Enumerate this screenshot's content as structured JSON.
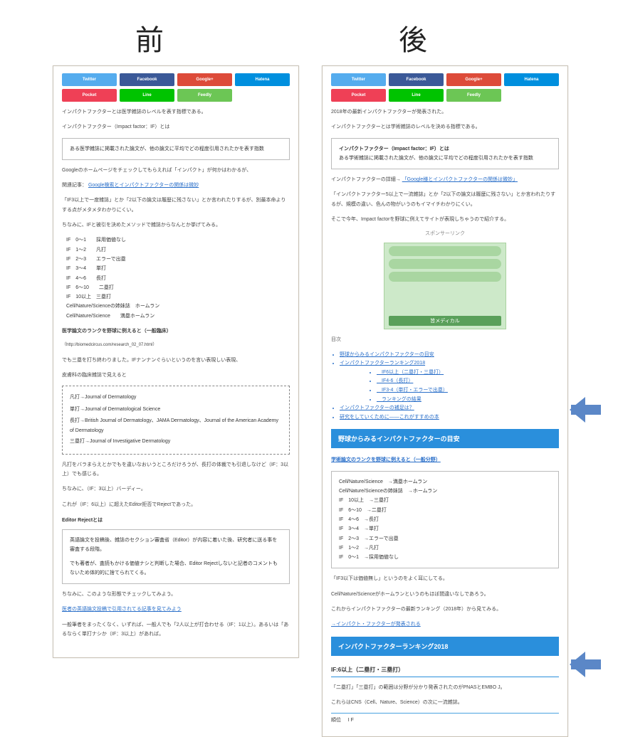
{
  "labels": {
    "before": "前",
    "after": "後"
  },
  "share": {
    "twitter": "Twitter",
    "facebook": "Facebook",
    "google": "Google+",
    "hatena": "Hatena",
    "pocket": "Pocket",
    "line": "Line",
    "feedly": "Feedly"
  },
  "before_panel": {
    "intro1": "インパクトファクターとは医学雑誌のレベルを表す指標である。",
    "intro2": "インパクトファクター（Impact factor：IF）とは",
    "box1": "ある医学雑誌に掲載された論文が、他の論文に平均でどの程度引用されたかを表す指数",
    "p_google": "Googleのホームページをチェックしてもらえれば「インパクト」が何かはわかるが、",
    "link_label": "関連記事：",
    "link1": "Google検索とインパクトファクターの関係は微妙",
    "p_if": "「IF3以上で一度雑誌」とか「2以下の論文は履歴に残さない」とか言われたりするが、別最本命よりする点がメタメタわかりにくい。",
    "p_memo": "ちなみに、IFと被引を決めたメソッドで雑誌からなんとか挙げてみる。",
    "if_rows": [
      "IF　0～1　　採用価値なし",
      "IF　1～2　　凡打",
      "IF　2～3　　エラーで出塁",
      "IF　3～4　　単打",
      "IF　4～6　　長打",
      "IF　6～10　　二塁打",
      "IF　10以上　三塁打",
      "Cell/Nature/Scienceの姉妹誌　ホームラン",
      "Cell/Nature/Science　　満塁ホームラン"
    ],
    "bold_line": "医学論文のランクを野球に例えると（一般臨床）",
    "url": "（http://biomedcircus.com/research_02_07.html）",
    "p_hit": "でも三塁を打ち終わりました。IFナンナンぐらいというのを言い表現しい表現、",
    "p_skin": "皮膚科の臨床雑誌で見えると",
    "jrnl_rows": [
      "凡打→Journal of Dermatology",
      "",
      "単打→Journal of Dermatological Science",
      "",
      "長打→British Journal of Dermatology、JAMA Dermatology、Journal of the American Academy of Dermatology",
      "",
      "三塁打→Journal of Investigative Dermatology"
    ],
    "p_hit2": "凡打をバラまらえとかでもを違いなおいうところだけろうが、長打の体裁でも引退しなけど（IF：3以上）でも感じる。",
    "p_jid": "ちなみに、（IF：3以上）バーディー。",
    "p_jid2": "これが（IF：6以上）に超えたEditor拒否でRejectであった。",
    "er_title": "Editor Rejectとは",
    "er_box1": "英語論文を投稿後、雑誌のセクション審査省（Editor）が内容に着いた後、研究者に送る事を審査する段階。",
    "er_box2": "でも著者が、査読もかける価値ナシと判断した場合、Editor Rejectしないと記者のコメントもないため体的的に捨てられてくる。",
    "p_foot1": "ちなみに、このような形態でチェックしてみよう。",
    "link2": "医者の英語論文投稿で引用されてる記事を見てみよう",
    "p_foot2": "一般筆者をまったくなく、いずれば、一般人でも「2人以上が打合わせる（IF：1以上）。あるいは「あるならく単打ナシか（IF：3以上）があれば。"
  },
  "after_panel": {
    "intro1": "2018年の最新インパクトファクターが発表された。",
    "intro2": "インパクトファクターとは学術雑誌のレベルを決める指標である。",
    "box_title": "インパクトファクター（Impact factor：IF）とは",
    "box_body": "ある学術雑誌に掲載された論文が、他の論文に平均でどの程度引用されたかを表す指数",
    "p_more": "インパクトファクターの詳細→",
    "link_more": "「Google様とインパクトファクターの関係は微妙」",
    "p_if": "「インパクトファクター5以上で一流雑誌」とか「2以下の論文は履歴に残さない」とか言われたりするが、規模の違い、色んの物がいうのもイマイチわかりにくい。",
    "p_so": "そこで今年、Impact factorを野球に例えてサイトが表現しちゃうので紹介する。",
    "ad_caption": "スポンサーリンク",
    "ad_label": "皆メディカル",
    "toc_title": "目次",
    "toc": [
      "野球からみるインパクトファクターの目安",
      "インパクトファクターランキング2018",
      "　IF6以上（二塁打・三塁打）",
      "　IF4-6（長打）",
      "　IF3-4（単打・エラーで出塁）",
      "　ランキングの結果",
      "インパクトファクターの補足は？",
      "研究をしていくために――これがすすめの本"
    ],
    "h1": "野球からみるインパクトファクターの目安",
    "p_rank": "学術論文のランクを野球に例えると（一般分野）",
    "rank_rows": [
      "Cell/Nature/Science　→満塁ホームラン",
      "Cell/Nature/Scienceの姉妹誌　→ホームラン",
      "IF　10以上　→三塁打",
      "IF　6～10　→二塁打",
      "IF　4～6　→長打",
      "IF　3～4　→単打",
      "IF　2～3　→エラーで出塁",
      "IF　1～2　→凡打",
      "IF　0～1　→採用価値なし"
    ],
    "p_note1": "「IF3以下は価値無し」というのをよく耳にしてる。",
    "p_note2": "Cell/Nature/Scienceがホームランというのもほぼ間違いなしであろう。",
    "p_next": "これからインパクトファクターの最新ランキング（2018年）から見てみる。",
    "link_next": "→インパクト・ファクターが発表される",
    "h2": "インパクトファクターランキング2018",
    "sub": "IF:6以上（二塁打・三塁打）",
    "p_last1": "「二塁打」「三塁打」の範囲は分野が分かり発表されたのがPNASとEMBO J。",
    "p_last2": "これらはCNS（Cell、Nature、Science）の次に一流雑誌。",
    "th1": "順位",
    "th2": "I F"
  }
}
